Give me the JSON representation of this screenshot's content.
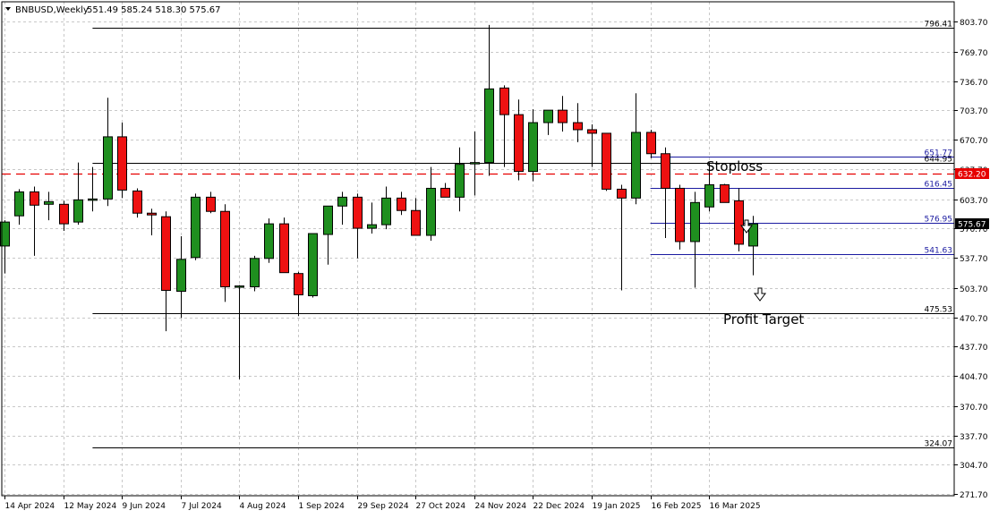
{
  "window": {
    "symbol_label": "BNBUSD,Weekly",
    "ohlc_label": "551.49 585.24 518.30 575.67"
  },
  "colors": {
    "bull": "#1f8f1f",
    "bear": "#ee1111",
    "wick": "#000000",
    "grid": "#c8c8c8",
    "level_black": "#000000",
    "level_blue": "#1a1aa0",
    "current_price_line": "#e60000",
    "last_price_badge": "#000000"
  },
  "annotations": {
    "stoploss": "Stoploss",
    "profit_target": "Profit Target"
  },
  "chart_data": {
    "type": "candlestick",
    "timeframe": "Weekly",
    "ylim": [
      271.7,
      812.0
    ],
    "y_ticks": [
      803.7,
      769.7,
      736.7,
      703.7,
      670.7,
      637.7,
      603.7,
      570.7,
      537.7,
      503.7,
      470.7,
      437.7,
      404.7,
      370.7,
      337.7,
      304.7,
      271.7
    ],
    "x_tick_labels": [
      "14 Apr 2024",
      "12 May 2024",
      "9 Jun 2024",
      "7 Jul 2024",
      "4 Aug 2024",
      "1 Sep 2024",
      "29 Sep 2024",
      "27 Oct 2024",
      "24 Nov 2024",
      "22 Dec 2024",
      "19 Jan 2025",
      "16 Feb 2025",
      "16 Mar 2025"
    ],
    "x_tick_bar_index": [
      0,
      4,
      8,
      12,
      16,
      20,
      24,
      28,
      32,
      36,
      40,
      44,
      48
    ],
    "current_price": 632.2,
    "last_price": 575.67,
    "levels": [
      {
        "label": "796.41",
        "value": 796.41,
        "style": "black"
      },
      {
        "label": "644.95",
        "value": 644.95,
        "style": "black"
      },
      {
        "label": "475.53",
        "value": 475.53,
        "style": "black"
      },
      {
        "label": "324.07",
        "value": 324.07,
        "style": "black"
      },
      {
        "label": "651.77",
        "value": 651.77,
        "style": "blue"
      },
      {
        "label": "616.45",
        "value": 616.45,
        "style": "blue"
      },
      {
        "label": "576.95",
        "value": 576.95,
        "style": "blue"
      },
      {
        "label": "541.63",
        "value": 541.63,
        "style": "blue"
      }
    ],
    "current_price_label": "632.20",
    "last_price_label": "575.67",
    "candles": [
      {
        "o": 551,
        "h": 580,
        "l": 520,
        "c": 578
      },
      {
        "o": 585,
        "h": 615,
        "l": 575,
        "c": 612
      },
      {
        "o": 612,
        "h": 618,
        "l": 540,
        "c": 597
      },
      {
        "o": 598,
        "h": 612,
        "l": 580,
        "c": 601
      },
      {
        "o": 598,
        "h": 602,
        "l": 568,
        "c": 576
      },
      {
        "o": 578,
        "h": 645,
        "l": 575,
        "c": 603
      },
      {
        "o": 603,
        "h": 640,
        "l": 590,
        "c": 604
      },
      {
        "o": 604,
        "h": 718,
        "l": 596,
        "c": 674
      },
      {
        "o": 674,
        "h": 690,
        "l": 605,
        "c": 614
      },
      {
        "o": 613,
        "h": 616,
        "l": 583,
        "c": 588
      },
      {
        "o": 588,
        "h": 593,
        "l": 563,
        "c": 586
      },
      {
        "o": 584,
        "h": 590,
        "l": 455,
        "c": 501
      },
      {
        "o": 500,
        "h": 562,
        "l": 470,
        "c": 536
      },
      {
        "o": 538,
        "h": 610,
        "l": 535,
        "c": 606
      },
      {
        "o": 606,
        "h": 612,
        "l": 588,
        "c": 590
      },
      {
        "o": 590,
        "h": 598,
        "l": 488,
        "c": 505
      },
      {
        "o": 505,
        "h": 507,
        "l": 401,
        "c": 506
      },
      {
        "o": 505,
        "h": 540,
        "l": 500,
        "c": 537
      },
      {
        "o": 537,
        "h": 582,
        "l": 532,
        "c": 576
      },
      {
        "o": 576,
        "h": 583,
        "l": 530,
        "c": 521
      },
      {
        "o": 520,
        "h": 522,
        "l": 472,
        "c": 496
      },
      {
        "o": 495,
        "h": 565,
        "l": 493,
        "c": 565
      },
      {
        "o": 564,
        "h": 585,
        "l": 530,
        "c": 596
      },
      {
        "o": 596,
        "h": 612,
        "l": 575,
        "c": 606
      },
      {
        "o": 606,
        "h": 610,
        "l": 537,
        "c": 571
      },
      {
        "o": 571,
        "h": 600,
        "l": 565,
        "c": 575
      },
      {
        "o": 575,
        "h": 618,
        "l": 570,
        "c": 605
      },
      {
        "o": 605,
        "h": 612,
        "l": 586,
        "c": 591
      },
      {
        "o": 591,
        "h": 605,
        "l": 563,
        "c": 563
      },
      {
        "o": 563,
        "h": 640,
        "l": 557,
        "c": 616
      },
      {
        "o": 616,
        "h": 622,
        "l": 606,
        "c": 606
      },
      {
        "o": 606,
        "h": 662,
        "l": 590,
        "c": 643
      },
      {
        "o": 644,
        "h": 680,
        "l": 608,
        "c": 645
      },
      {
        "o": 645,
        "h": 800,
        "l": 630,
        "c": 728
      },
      {
        "o": 729,
        "h": 732,
        "l": 640,
        "c": 699
      },
      {
        "o": 699,
        "h": 716,
        "l": 625,
        "c": 635
      },
      {
        "o": 635,
        "h": 705,
        "l": 624,
        "c": 690
      },
      {
        "o": 690,
        "h": 700,
        "l": 676,
        "c": 704
      },
      {
        "o": 704,
        "h": 720,
        "l": 680,
        "c": 690
      },
      {
        "o": 690,
        "h": 712,
        "l": 668,
        "c": 682
      },
      {
        "o": 682,
        "h": 688,
        "l": 640,
        "c": 678
      },
      {
        "o": 678,
        "h": 672,
        "l": 613,
        "c": 615
      },
      {
        "o": 615,
        "h": 620,
        "l": 501,
        "c": 605
      },
      {
        "o": 605,
        "h": 723,
        "l": 598,
        "c": 679
      },
      {
        "o": 679,
        "h": 682,
        "l": 650,
        "c": 655
      },
      {
        "o": 655,
        "h": 662,
        "l": 560,
        "c": 616
      },
      {
        "o": 616,
        "h": 620,
        "l": 547,
        "c": 556
      },
      {
        "o": 556,
        "h": 612,
        "l": 504,
        "c": 600
      },
      {
        "o": 595,
        "h": 645,
        "l": 590,
        "c": 620
      },
      {
        "o": 620,
        "h": 621,
        "l": 600,
        "c": 600
      },
      {
        "o": 602,
        "h": 616,
        "l": 545,
        "c": 553
      },
      {
        "o": 551,
        "h": 585,
        "l": 518,
        "c": 576
      }
    ]
  }
}
